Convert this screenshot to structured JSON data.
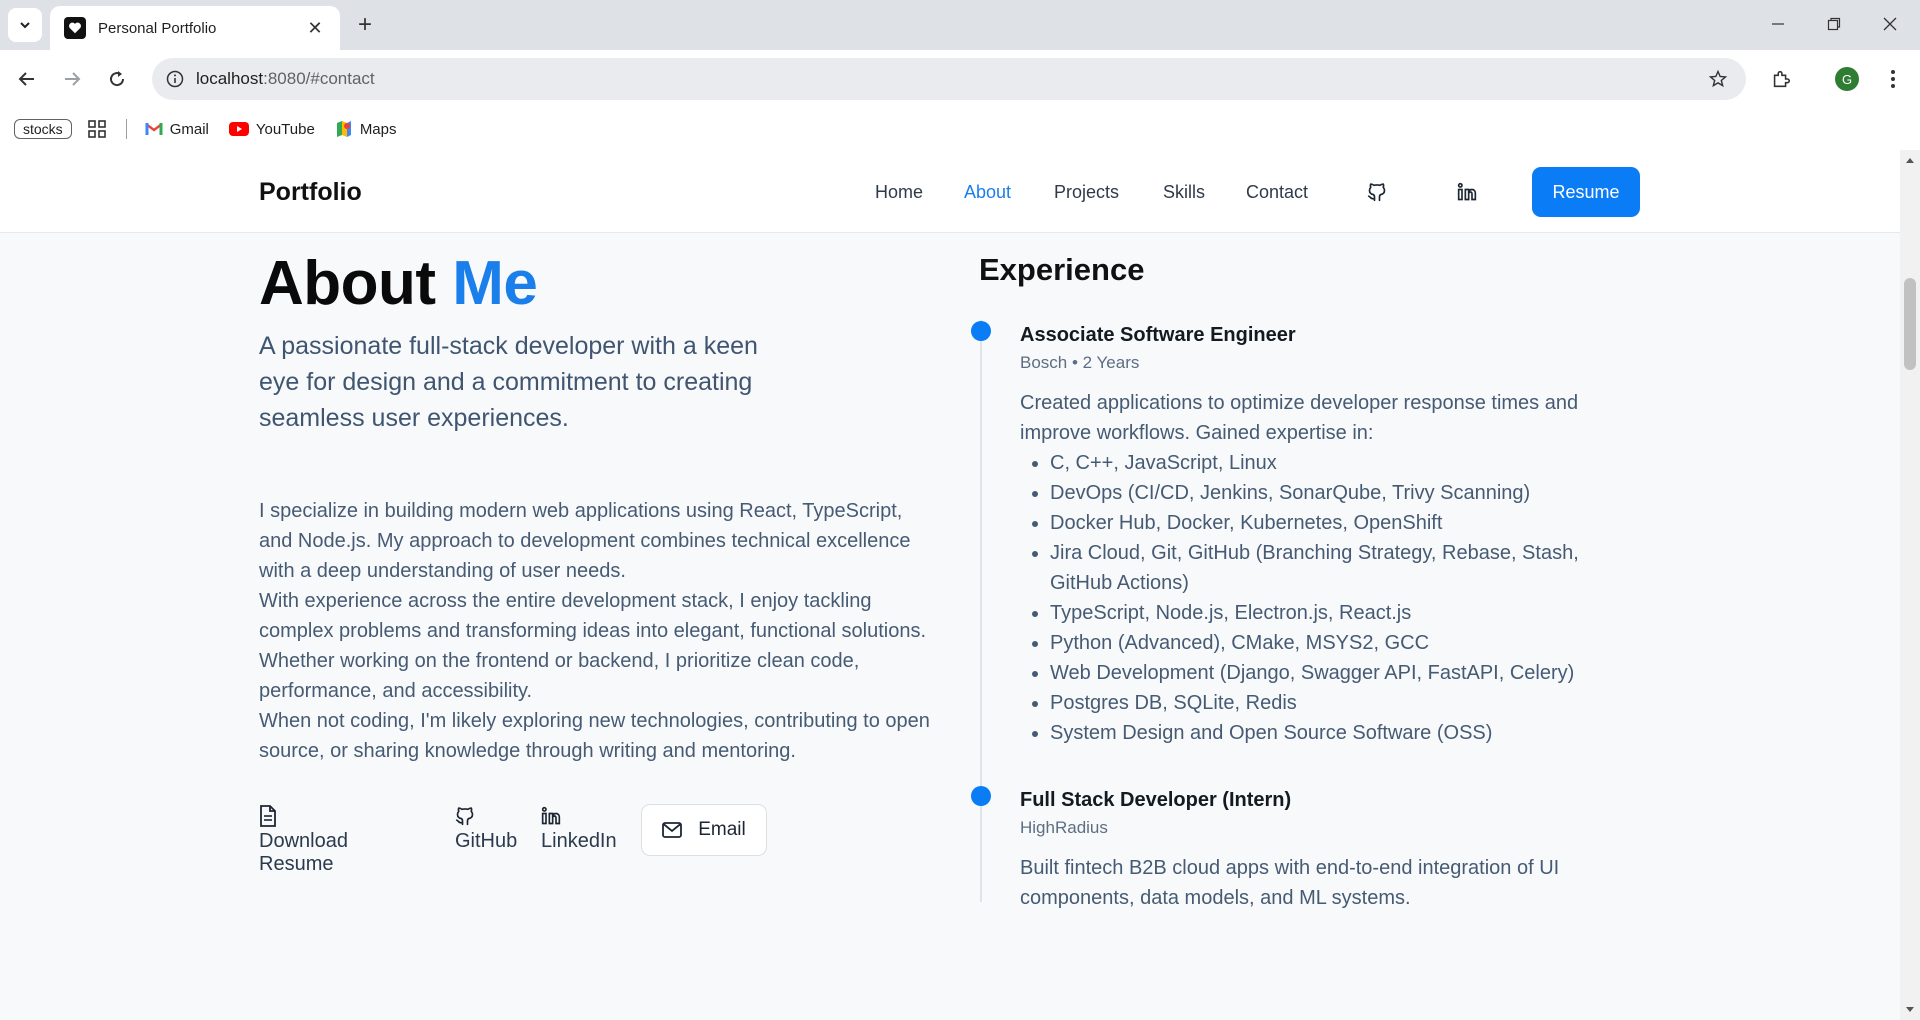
{
  "browser": {
    "tab_title": "Personal Portfolio",
    "url_host": "localhost",
    "url_rest": ":8080/#contact",
    "bookmarks": {
      "stocks": "stocks",
      "gmail": "Gmail",
      "youtube": "YouTube",
      "maps": "Maps"
    },
    "profile_initial": "G"
  },
  "header": {
    "brand": "Portfolio",
    "nav": [
      "Home",
      "About",
      "Projects",
      "Skills",
      "Contact"
    ],
    "active_nav": "About",
    "resume_label": "Resume"
  },
  "about": {
    "title_part1": "About",
    "title_part2": "Me",
    "lead": "A passionate full-stack developer with a keen eye for design and a commitment to creating seamless user experiences.",
    "bio": [
      "I specialize in building modern web applications using React, TypeScript, and Node.js. My approach to development combines technical excellence with a deep understanding of user needs.",
      "With experience across the entire development stack, I enjoy tackling complex problems and transforming ideas into elegant, functional solutions. Whether working on the frontend or backend, I prioritize clean code, performance, and accessibility.",
      "When not coding, I'm likely exploring new technologies, contributing to open source, or sharing knowledge through writing and mentoring."
    ],
    "links": {
      "download_resume": "Download Resume",
      "github": "GitHub",
      "linkedin": "LinkedIn",
      "email": "Email"
    }
  },
  "experience": {
    "title": "Experience",
    "jobs": [
      {
        "role": "Associate Software Engineer",
        "meta": "Bosch • 2 Years",
        "desc": "Created applications to optimize developer response times and improve workflows. Gained expertise in:",
        "skills": [
          "C, C++, JavaScript, Linux",
          "DevOps (CI/CD, Jenkins, SonarQube, Trivy Scanning)",
          "Docker Hub, Docker, Kubernetes, OpenShift",
          "Jira Cloud, Git, GitHub (Branching Strategy, Rebase, Stash, GitHub Actions)",
          "TypeScript, Node.js, Electron.js, React.js",
          "Python (Advanced), CMake, MSYS2, GCC",
          "Web Development (Django, Swagger API, FastAPI, Celery)",
          "Postgres DB, SQLite, Redis",
          "System Design and Open Source Software (OSS)"
        ]
      },
      {
        "role": "Full Stack Developer (Intern)",
        "meta": "HighRadius",
        "desc": "Built fintech B2B cloud apps with end-to-end integration of UI components, data models, and ML systems."
      }
    ]
  },
  "colors": {
    "accent": "#1a7fea",
    "button": "#0a7cf5",
    "text_muted": "#465b73"
  }
}
